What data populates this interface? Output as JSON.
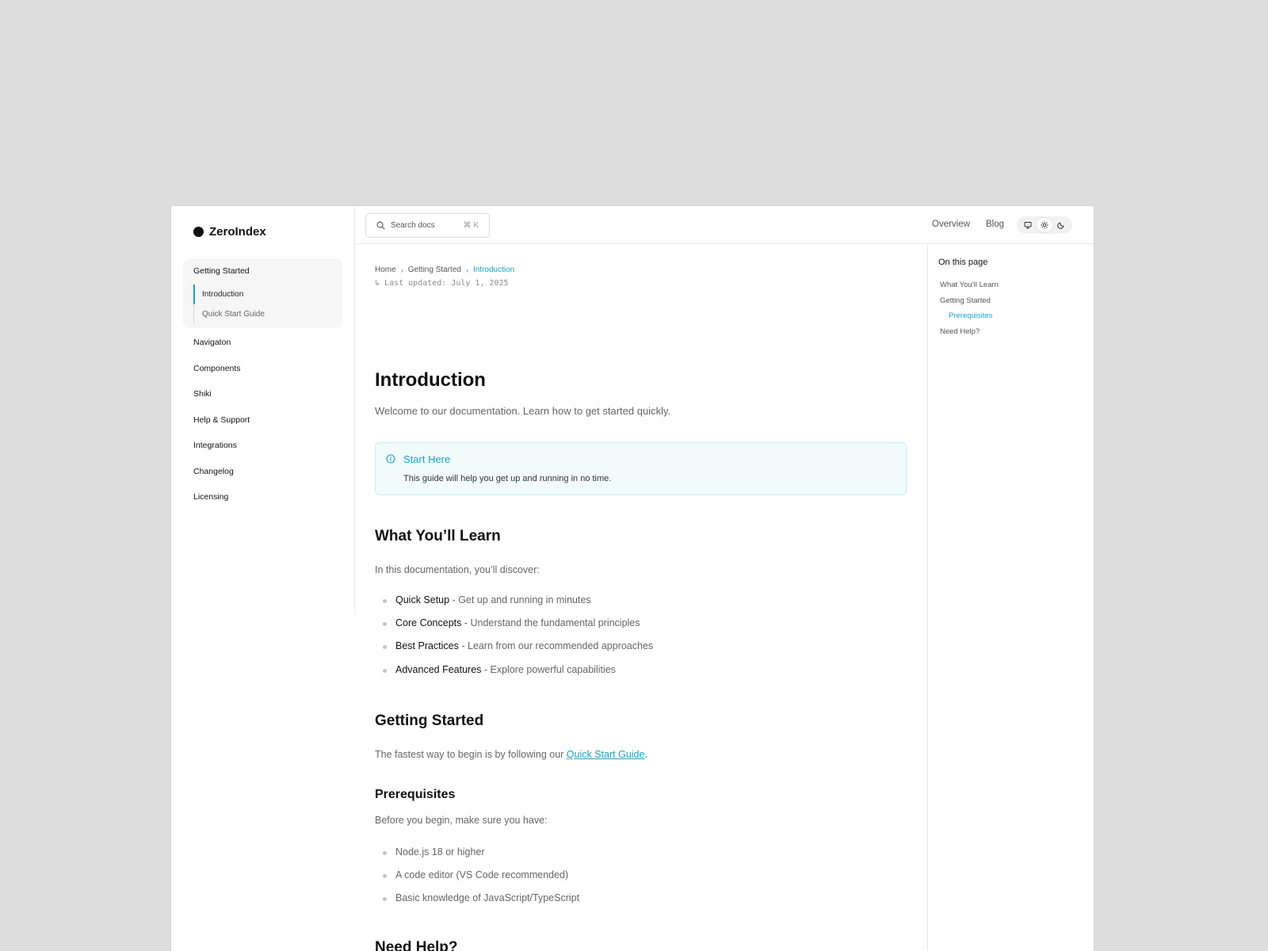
{
  "brand": {
    "name": "ZeroIndex"
  },
  "sidebar": {
    "group": {
      "title": "Getting Started",
      "items": [
        {
          "label": "Introduction",
          "active": true
        },
        {
          "label": "Quick Start Guide",
          "active": false
        }
      ]
    },
    "items": [
      {
        "label": "Navigaton"
      },
      {
        "label": "Components"
      },
      {
        "label": "Shiki"
      },
      {
        "label": "Help & Support"
      },
      {
        "label": "Integrations"
      },
      {
        "label": "Changelog"
      },
      {
        "label": "Licensing"
      }
    ]
  },
  "header": {
    "search_placeholder": "Search docs",
    "search_shortcut": "⌘ K",
    "links": [
      {
        "label": "Overview"
      },
      {
        "label": "Blog"
      }
    ],
    "theme_options": [
      {
        "icon": "monitor-icon",
        "active": false
      },
      {
        "icon": "sun-icon",
        "active": true
      },
      {
        "icon": "moon-icon",
        "active": false
      }
    ]
  },
  "breadcrumb": {
    "items": [
      "Home",
      "Getting Started",
      "Introduction"
    ],
    "updated": "Last updated: July 1, 2025"
  },
  "content": {
    "title": "Introduction",
    "lead": "Welcome to our documentation. Learn how to get started quickly.",
    "callout": {
      "title": "Start Here",
      "text": "This guide will help you get up and running in no time."
    },
    "learn": {
      "heading": "What You’ll Learn",
      "intro": "In this documentation, you’ll discover:",
      "items": [
        {
          "term": "Quick Setup",
          "desc": " - Get up and running in minutes"
        },
        {
          "term": "Core Concepts",
          "desc": " - Understand the fundamental principles"
        },
        {
          "term": "Best Practices",
          "desc": " - Learn from our recommended approaches"
        },
        {
          "term": "Advanced Features",
          "desc": " - Explore powerful capabilities"
        }
      ]
    },
    "getting_started": {
      "heading": "Getting Started",
      "text_before": "The fastest way to begin is by following our ",
      "link": "Quick Start Guide",
      "text_after": "."
    },
    "prerequisites": {
      "heading": "Prerequisites",
      "intro": "Before you begin, make sure you have:",
      "items": [
        "Node.js 18 or higher",
        "A code editor (VS Code recommended)",
        "Basic knowledge of JavaScript/TypeScript"
      ]
    },
    "need_help": {
      "heading": "Need Help?"
    }
  },
  "toc": {
    "title": "On this page",
    "items": [
      {
        "label": "What You’ll Learn",
        "sub": false,
        "active": false
      },
      {
        "label": "Getting Started",
        "sub": false,
        "active": false
      },
      {
        "label": "Prerequisites",
        "sub": true,
        "active": true
      },
      {
        "label": "Need Help?",
        "sub": false,
        "active": false
      }
    ]
  },
  "colors": {
    "accent": "#17a3c7",
    "callout_bg": "#f1fbfc",
    "callout_border": "#c7eef4"
  }
}
